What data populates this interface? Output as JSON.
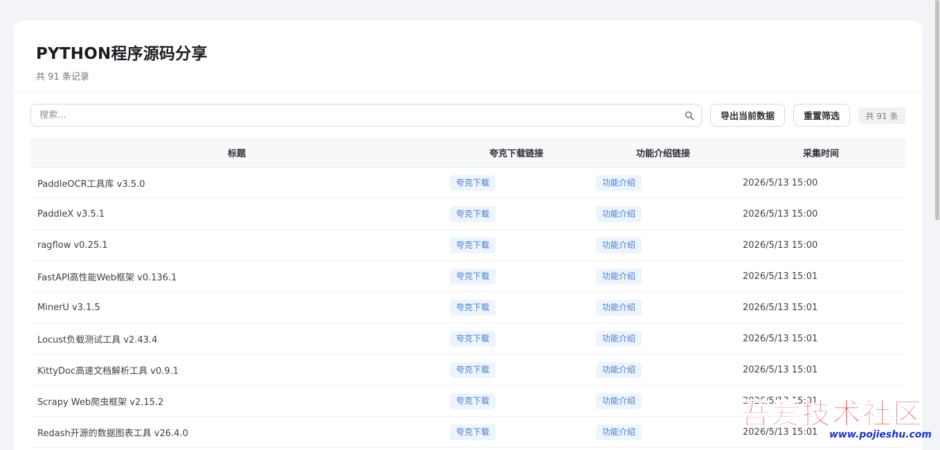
{
  "header": {
    "title": "PYTHON程序源码分享",
    "subtitle": "共 91 条记录"
  },
  "toolbar": {
    "search_placeholder": "搜索...",
    "export_label": "导出当前数据",
    "reset_label": "重置筛选",
    "count_label": "共 91 条"
  },
  "table": {
    "columns": [
      "标题",
      "夸克下载链接",
      "功能介绍链接",
      "采集时间"
    ],
    "rows": [
      {
        "title": "PaddleOCR工具库 v3.5.0",
        "quark": "夸克下载",
        "intro": "功能介绍",
        "time": "2026/5/13 15:00"
      },
      {
        "title": "PaddleX v3.5.1",
        "quark": "夸克下载",
        "intro": "功能介绍",
        "time": "2026/5/13 15:00"
      },
      {
        "title": "ragflow v0.25.1",
        "quark": "夸克下载",
        "intro": "功能介绍",
        "time": "2026/5/13 15:00"
      },
      {
        "title": "FastAPI高性能Web框架 v0.136.1",
        "quark": "夸克下载",
        "intro": "功能介绍",
        "time": "2026/5/13 15:01"
      },
      {
        "title": "MinerU v3.1.5",
        "quark": "夸克下载",
        "intro": "功能介绍",
        "time": "2026/5/13 15:01"
      },
      {
        "title": "Locust负载测试工具 v2.43.4",
        "quark": "夸克下载",
        "intro": "功能介绍",
        "time": "2026/5/13 15:01"
      },
      {
        "title": "KittyDoc高速文档解析工具 v0.9.1",
        "quark": "夸克下载",
        "intro": "功能介绍",
        "time": "2026/5/13 15:01"
      },
      {
        "title": "Scrapy Web爬虫框架 v2.15.2",
        "quark": "夸克下载",
        "intro": "功能介绍",
        "time": "2026/5/13 15:01"
      },
      {
        "title": "Redash开源的数据图表工具 v26.4.0",
        "quark": "夸克下载",
        "intro": "功能介绍",
        "time": "2026/5/13 15:01"
      }
    ]
  },
  "watermark": {
    "text": "吾爱技术社区",
    "url": "www.pojieshu.com"
  },
  "colors": {
    "page_bg": "#f3f4f7",
    "tag_bg": "#eef4fc",
    "tag_text": "#3d7fd6",
    "watermark_red": "#e8191e",
    "watermark_url": "#1a2fd8"
  }
}
